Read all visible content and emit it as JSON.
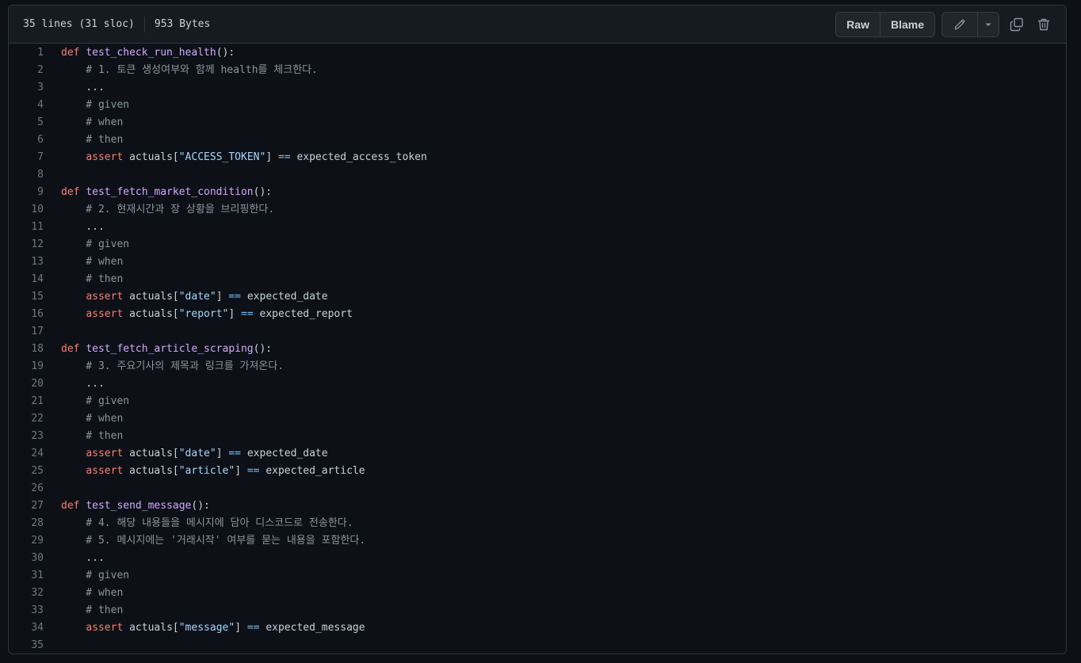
{
  "file": {
    "lines_info": "35 lines (31 sloc)",
    "size": "953 Bytes"
  },
  "toolbar": {
    "raw_label": "Raw",
    "blame_label": "Blame",
    "icons": [
      "pencil-icon",
      "triangle-down-icon",
      "copy-icon",
      "trash-icon"
    ]
  },
  "colors": {
    "keyword": "#ff7b72",
    "function": "#d2a8ff",
    "string": "#a5d6ff",
    "operator": "#79c0ff",
    "comment": "#8b949e",
    "line_number": "#6e7681"
  },
  "code_lines": [
    [
      [
        "kw",
        "def"
      ],
      [
        "t",
        " "
      ],
      [
        "fn",
        "test_check_run_health"
      ],
      [
        "t",
        "():"
      ]
    ],
    [
      [
        "cm",
        "    # 1. 토큰 생성여부와 함께 health를 체크한다."
      ]
    ],
    [
      [
        "t",
        "    ..."
      ]
    ],
    [
      [
        "cm",
        "    # given"
      ]
    ],
    [
      [
        "cm",
        "    # when"
      ]
    ],
    [
      [
        "cm",
        "    # then"
      ]
    ],
    [
      [
        "t",
        "    "
      ],
      [
        "kw",
        "assert"
      ],
      [
        "t",
        " actuals["
      ],
      [
        "str",
        "\"ACCESS_TOKEN\""
      ],
      [
        "t",
        "] "
      ],
      [
        "op",
        "=="
      ],
      [
        "t",
        " expected_access_token"
      ]
    ],
    [],
    [
      [
        "kw",
        "def"
      ],
      [
        "t",
        " "
      ],
      [
        "fn",
        "test_fetch_market_condition"
      ],
      [
        "t",
        "():"
      ]
    ],
    [
      [
        "cm",
        "    # 2. 현재시간과 장 상황을 브리핑한다."
      ]
    ],
    [
      [
        "t",
        "    ..."
      ]
    ],
    [
      [
        "cm",
        "    # given"
      ]
    ],
    [
      [
        "cm",
        "    # when"
      ]
    ],
    [
      [
        "cm",
        "    # then"
      ]
    ],
    [
      [
        "t",
        "    "
      ],
      [
        "kw",
        "assert"
      ],
      [
        "t",
        " actuals["
      ],
      [
        "str",
        "\"date\""
      ],
      [
        "t",
        "] "
      ],
      [
        "op",
        "=="
      ],
      [
        "t",
        " expected_date"
      ]
    ],
    [
      [
        "t",
        "    "
      ],
      [
        "kw",
        "assert"
      ],
      [
        "t",
        " actuals["
      ],
      [
        "str",
        "\"report\""
      ],
      [
        "t",
        "] "
      ],
      [
        "op",
        "=="
      ],
      [
        "t",
        " expected_report"
      ]
    ],
    [],
    [
      [
        "kw",
        "def"
      ],
      [
        "t",
        " "
      ],
      [
        "fn",
        "test_fetch_article_scraping"
      ],
      [
        "t",
        "():"
      ]
    ],
    [
      [
        "cm",
        "    # 3. 주요기사의 제목과 링크를 가져온다."
      ]
    ],
    [
      [
        "t",
        "    ..."
      ]
    ],
    [
      [
        "cm",
        "    # given"
      ]
    ],
    [
      [
        "cm",
        "    # when"
      ]
    ],
    [
      [
        "cm",
        "    # then"
      ]
    ],
    [
      [
        "t",
        "    "
      ],
      [
        "kw",
        "assert"
      ],
      [
        "t",
        " actuals["
      ],
      [
        "str",
        "\"date\""
      ],
      [
        "t",
        "] "
      ],
      [
        "op",
        "=="
      ],
      [
        "t",
        " expected_date"
      ]
    ],
    [
      [
        "t",
        "    "
      ],
      [
        "kw",
        "assert"
      ],
      [
        "t",
        " actuals["
      ],
      [
        "str",
        "\"article\""
      ],
      [
        "t",
        "] "
      ],
      [
        "op",
        "=="
      ],
      [
        "t",
        " expected_article"
      ]
    ],
    [],
    [
      [
        "kw",
        "def"
      ],
      [
        "t",
        " "
      ],
      [
        "fn",
        "test_send_message"
      ],
      [
        "t",
        "():"
      ]
    ],
    [
      [
        "cm",
        "    # 4. 해당 내용들을 메시지에 담아 디스코드로 전송한다."
      ]
    ],
    [
      [
        "cm",
        "    # 5. 메시지에는 '거래시작' 여부를 묻는 내용을 포함한다."
      ]
    ],
    [
      [
        "t",
        "    ..."
      ]
    ],
    [
      [
        "cm",
        "    # given"
      ]
    ],
    [
      [
        "cm",
        "    # when"
      ]
    ],
    [
      [
        "cm",
        "    # then"
      ]
    ],
    [
      [
        "t",
        "    "
      ],
      [
        "kw",
        "assert"
      ],
      [
        "t",
        " actuals["
      ],
      [
        "str",
        "\"message\""
      ],
      [
        "t",
        "] "
      ],
      [
        "op",
        "=="
      ],
      [
        "t",
        " expected_message"
      ]
    ],
    []
  ]
}
